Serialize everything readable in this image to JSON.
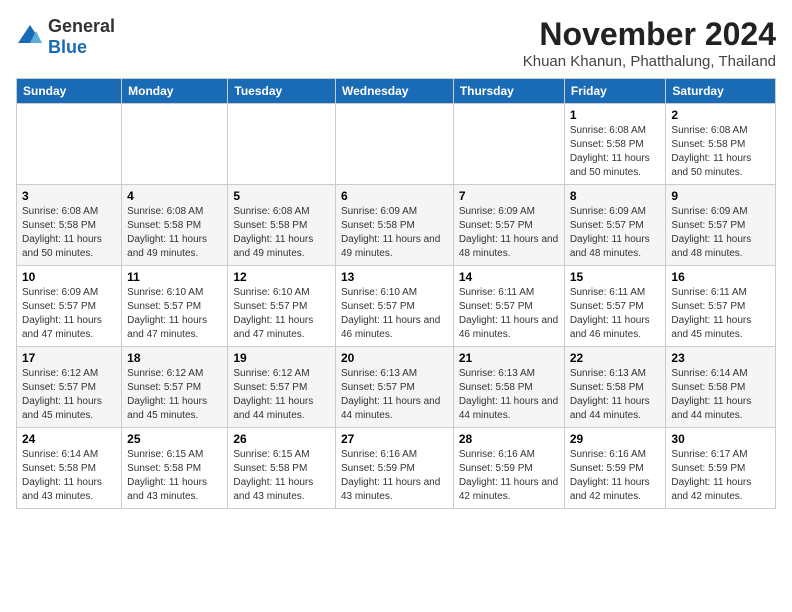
{
  "logo": {
    "text_general": "General",
    "text_blue": "Blue"
  },
  "title": "November 2024",
  "subtitle": "Khuan Khanun, Phatthalung, Thailand",
  "days_of_week": [
    "Sunday",
    "Monday",
    "Tuesday",
    "Wednesday",
    "Thursday",
    "Friday",
    "Saturday"
  ],
  "weeks": [
    [
      {
        "day": "",
        "info": ""
      },
      {
        "day": "",
        "info": ""
      },
      {
        "day": "",
        "info": ""
      },
      {
        "day": "",
        "info": ""
      },
      {
        "day": "",
        "info": ""
      },
      {
        "day": "1",
        "info": "Sunrise: 6:08 AM\nSunset: 5:58 PM\nDaylight: 11 hours and 50 minutes."
      },
      {
        "day": "2",
        "info": "Sunrise: 6:08 AM\nSunset: 5:58 PM\nDaylight: 11 hours and 50 minutes."
      }
    ],
    [
      {
        "day": "3",
        "info": "Sunrise: 6:08 AM\nSunset: 5:58 PM\nDaylight: 11 hours and 50 minutes."
      },
      {
        "day": "4",
        "info": "Sunrise: 6:08 AM\nSunset: 5:58 PM\nDaylight: 11 hours and 49 minutes."
      },
      {
        "day": "5",
        "info": "Sunrise: 6:08 AM\nSunset: 5:58 PM\nDaylight: 11 hours and 49 minutes."
      },
      {
        "day": "6",
        "info": "Sunrise: 6:09 AM\nSunset: 5:58 PM\nDaylight: 11 hours and 49 minutes."
      },
      {
        "day": "7",
        "info": "Sunrise: 6:09 AM\nSunset: 5:57 PM\nDaylight: 11 hours and 48 minutes."
      },
      {
        "day": "8",
        "info": "Sunrise: 6:09 AM\nSunset: 5:57 PM\nDaylight: 11 hours and 48 minutes."
      },
      {
        "day": "9",
        "info": "Sunrise: 6:09 AM\nSunset: 5:57 PM\nDaylight: 11 hours and 48 minutes."
      }
    ],
    [
      {
        "day": "10",
        "info": "Sunrise: 6:09 AM\nSunset: 5:57 PM\nDaylight: 11 hours and 47 minutes."
      },
      {
        "day": "11",
        "info": "Sunrise: 6:10 AM\nSunset: 5:57 PM\nDaylight: 11 hours and 47 minutes."
      },
      {
        "day": "12",
        "info": "Sunrise: 6:10 AM\nSunset: 5:57 PM\nDaylight: 11 hours and 47 minutes."
      },
      {
        "day": "13",
        "info": "Sunrise: 6:10 AM\nSunset: 5:57 PM\nDaylight: 11 hours and 46 minutes."
      },
      {
        "day": "14",
        "info": "Sunrise: 6:11 AM\nSunset: 5:57 PM\nDaylight: 11 hours and 46 minutes."
      },
      {
        "day": "15",
        "info": "Sunrise: 6:11 AM\nSunset: 5:57 PM\nDaylight: 11 hours and 46 minutes."
      },
      {
        "day": "16",
        "info": "Sunrise: 6:11 AM\nSunset: 5:57 PM\nDaylight: 11 hours and 45 minutes."
      }
    ],
    [
      {
        "day": "17",
        "info": "Sunrise: 6:12 AM\nSunset: 5:57 PM\nDaylight: 11 hours and 45 minutes."
      },
      {
        "day": "18",
        "info": "Sunrise: 6:12 AM\nSunset: 5:57 PM\nDaylight: 11 hours and 45 minutes."
      },
      {
        "day": "19",
        "info": "Sunrise: 6:12 AM\nSunset: 5:57 PM\nDaylight: 11 hours and 44 minutes."
      },
      {
        "day": "20",
        "info": "Sunrise: 6:13 AM\nSunset: 5:57 PM\nDaylight: 11 hours and 44 minutes."
      },
      {
        "day": "21",
        "info": "Sunrise: 6:13 AM\nSunset: 5:58 PM\nDaylight: 11 hours and 44 minutes."
      },
      {
        "day": "22",
        "info": "Sunrise: 6:13 AM\nSunset: 5:58 PM\nDaylight: 11 hours and 44 minutes."
      },
      {
        "day": "23",
        "info": "Sunrise: 6:14 AM\nSunset: 5:58 PM\nDaylight: 11 hours and 44 minutes."
      }
    ],
    [
      {
        "day": "24",
        "info": "Sunrise: 6:14 AM\nSunset: 5:58 PM\nDaylight: 11 hours and 43 minutes."
      },
      {
        "day": "25",
        "info": "Sunrise: 6:15 AM\nSunset: 5:58 PM\nDaylight: 11 hours and 43 minutes."
      },
      {
        "day": "26",
        "info": "Sunrise: 6:15 AM\nSunset: 5:58 PM\nDaylight: 11 hours and 43 minutes."
      },
      {
        "day": "27",
        "info": "Sunrise: 6:16 AM\nSunset: 5:59 PM\nDaylight: 11 hours and 43 minutes."
      },
      {
        "day": "28",
        "info": "Sunrise: 6:16 AM\nSunset: 5:59 PM\nDaylight: 11 hours and 42 minutes."
      },
      {
        "day": "29",
        "info": "Sunrise: 6:16 AM\nSunset: 5:59 PM\nDaylight: 11 hours and 42 minutes."
      },
      {
        "day": "30",
        "info": "Sunrise: 6:17 AM\nSunset: 5:59 PM\nDaylight: 11 hours and 42 minutes."
      }
    ]
  ]
}
